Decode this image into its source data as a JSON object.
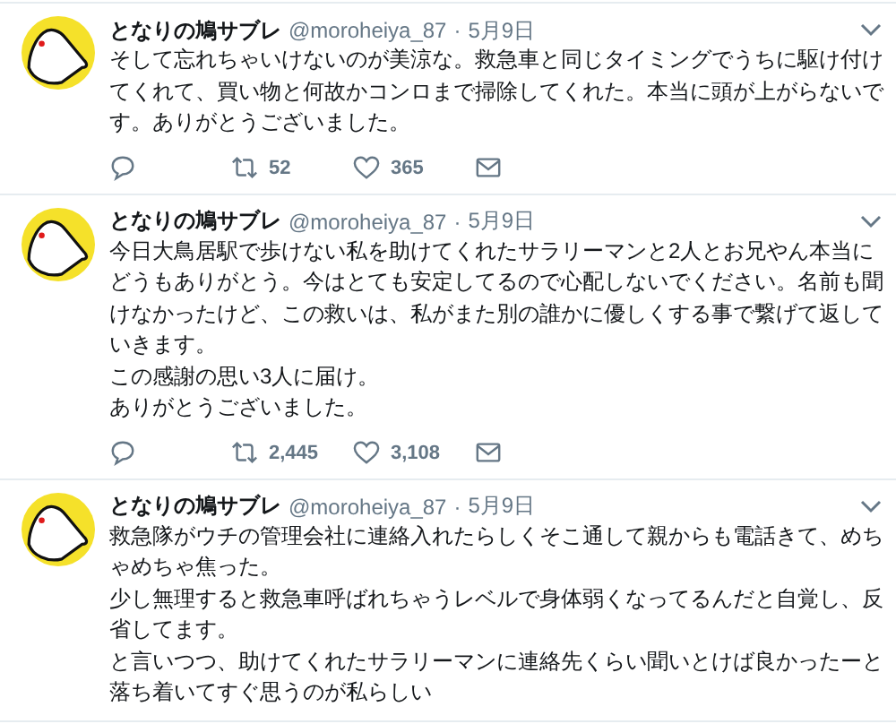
{
  "tweets": [
    {
      "name": "となりの鳩サブレ",
      "handle": "@moroheiya_87",
      "separator": "·",
      "date": "5月9日",
      "paragraphs": [
        "そして忘れちゃいけないのが美涼な。救急車と同じタイミングでうちに駆け付けてくれて、買い物と何故かコンロまで掃除してくれた。本当に頭が上がらないです。ありがとうございました。"
      ],
      "retweets": "52",
      "likes": "365"
    },
    {
      "name": "となりの鳩サブレ",
      "handle": "@moroheiya_87",
      "separator": "·",
      "date": "5月9日",
      "paragraphs": [
        "今日大鳥居駅で歩けない私を助けてくれたサラリーマンと2人とお兄やん本当にどうもありがとう。今はとても安定してるので心配しないでください。名前も聞けなかったけど、この救いは、私がまた別の誰かに優しくする事で繋げて返していきます。",
        "この感謝の思い3人に届け。",
        "ありがとうございました。"
      ],
      "retweets": "2,445",
      "likes": "3,108"
    },
    {
      "name": "となりの鳩サブレ",
      "handle": "@moroheiya_87",
      "separator": "·",
      "date": "5月9日",
      "paragraphs": [
        "救急隊がウチの管理会社に連絡入れたらしくそこ通して親からも電話きて、めちゃめちゃ焦った。",
        "少し無理すると救急車呼ばれちゃうレベルで身体弱くなってるんだと自覚し、反省してます。",
        "と言いつつ、助けてくれたサラリーマンに連絡先くらい聞いとけば良かったーと落ち着いてすぐ思うのが私らしい"
      ]
    }
  ]
}
